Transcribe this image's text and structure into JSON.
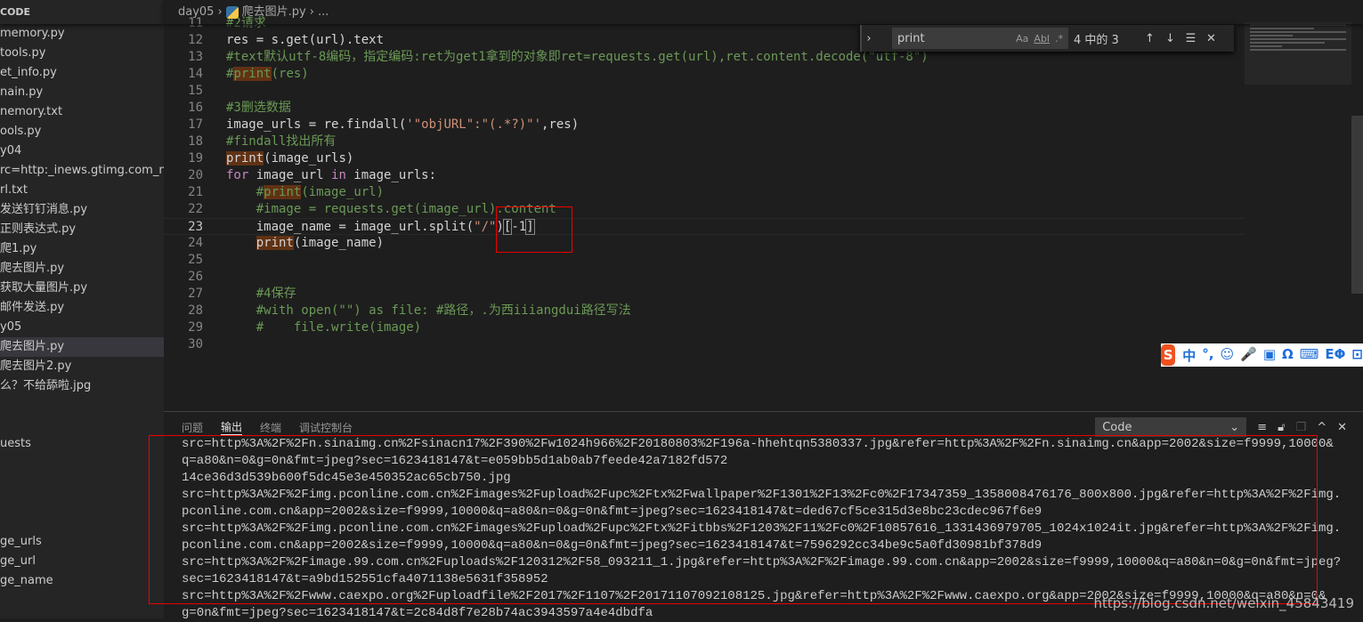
{
  "sidebar": {
    "header": "CODE",
    "items": [
      "memory.py",
      "tools.py",
      "et_info.py",
      "nain.py",
      "nemory.txt",
      "ools.py",
      "y04",
      "rc=http:_inews.gtimg.com_ne...",
      "rl.txt",
      "发送钉钉消息.py",
      "正则表达式.py",
      "爬1.py",
      "爬去图片.py",
      "获取大量图片.py",
      "邮件发送.py",
      "y05",
      "爬去图片.py",
      "爬去图片2.py",
      "么？不给舔啦.jpg"
    ],
    "selected_index": 16,
    "outline": [
      "uests",
      "",
      "",
      "",
      "",
      "ge_urls",
      "ge_url",
      "ge_name"
    ]
  },
  "breadcrumb": {
    "folder": "day05",
    "file": "爬去图片.py",
    "more": "..."
  },
  "find": {
    "query": "print",
    "case_label": "Aa",
    "word_label": "Abl",
    "regex_label": ".*",
    "count": "4 中的 3"
  },
  "code": [
    {
      "n": "11",
      "t": [
        [
          "#2请求",
          "c"
        ]
      ]
    },
    {
      "n": "12",
      "t": [
        [
          "res = s.get(url).text",
          "d"
        ]
      ]
    },
    {
      "n": "13",
      "t": [
        [
          "#text默认utf-8编码，指定编码:ret为get1拿到的对象即ret=requests.get(url),ret.content.decode(\"utf-8\")",
          "c"
        ]
      ]
    },
    {
      "n": "14",
      "t": [
        [
          "#",
          "c"
        ],
        [
          "print",
          "c m"
        ],
        [
          "(res)",
          "c"
        ]
      ]
    },
    {
      "n": "15",
      "t": []
    },
    {
      "n": "16",
      "t": [
        [
          "#3删选数据",
          "c"
        ]
      ]
    },
    {
      "n": "17",
      "t": [
        [
          "image_urls = re.findall(",
          "d"
        ],
        [
          "'\"objURL\":\"(.*?)\"'",
          "s"
        ],
        [
          ",res)",
          "d"
        ]
      ]
    },
    {
      "n": "18",
      "t": [
        [
          "#findall找出所有",
          "c"
        ]
      ]
    },
    {
      "n": "19",
      "t": [
        [
          "print",
          "d m"
        ],
        [
          "(image_urls)",
          "d"
        ]
      ]
    },
    {
      "n": "20",
      "t": [
        [
          "for",
          "k"
        ],
        [
          " image_url ",
          "d"
        ],
        [
          "in",
          "k"
        ],
        [
          " image_urls:",
          "d"
        ]
      ]
    },
    {
      "n": "21",
      "t": [
        [
          "    #",
          "c"
        ],
        [
          "print",
          "c m"
        ],
        [
          "(image_url)",
          "c"
        ]
      ]
    },
    {
      "n": "22",
      "t": [
        [
          "    #image = requests.get(image_url).content",
          "c"
        ]
      ]
    },
    {
      "n": "23",
      "t": [
        [
          "    image_name = image_url.split(",
          "d"
        ],
        [
          "\"/\"",
          "s"
        ],
        [
          ")",
          "d"
        ],
        [
          "[",
          "d b"
        ],
        [
          "-1",
          "d"
        ],
        [
          "]",
          "d b"
        ]
      ],
      "current": true
    },
    {
      "n": "24",
      "t": [
        [
          "    ",
          "d"
        ],
        [
          "print",
          "d m"
        ],
        [
          "(image_name)",
          "d"
        ]
      ]
    },
    {
      "n": "25",
      "t": []
    },
    {
      "n": "26",
      "t": []
    },
    {
      "n": "27",
      "t": [
        [
          "    #4保存",
          "c"
        ]
      ]
    },
    {
      "n": "28",
      "t": [
        [
          "    #with open(\"\") as file: #路径，.为西iiiangdui路径写法",
          "c"
        ]
      ]
    },
    {
      "n": "29",
      "t": [
        [
          "    #    file.write(image)",
          "c"
        ]
      ]
    },
    {
      "n": "30",
      "t": []
    }
  ],
  "panel": {
    "tabs": [
      "问题",
      "输出",
      "终端",
      "调试控制台"
    ],
    "active": 1,
    "channel": "Code",
    "output": [
      "src=http%3A%2F%2Fn.sinaimg.cn%2Fsinacn17%2F390%2Fw1024h966%2F20180803%2F196a-hhehtqn5380337.jpg&refer=http%3A%2F%2Fn.sinaimg.cn&app=2002&size=f9999,10000&",
      "q=a80&n=0&g=0n&fmt=jpeg?sec=1623418147&t=e059bb5d1ab0ab7feede42a7182fd572",
      "14ce36d3d539b600f5dc45e3e450352ac65cb750.jpg",
      "src=http%3A%2F%2Fimg.pconline.com.cn%2Fimages%2Fupload%2Fupc%2Ftx%2Fwallpaper%2F1301%2F13%2Fc0%2F17347359_1358008476176_800x800.jpg&refer=http%3A%2F%2Fimg.",
      "pconline.com.cn&app=2002&size=f9999,10000&q=a80&n=0&g=0n&fmt=jpeg?sec=1623418147&t=ded67cf5ce315d3e8bc23cdec967f6e9",
      "src=http%3A%2F%2Fimg.pconline.com.cn%2Fimages%2Fupload%2Fupc%2Ftx%2Fitbbs%2F1203%2F11%2Fc0%2F10857616_1331436979705_1024x1024it.jpg&refer=http%3A%2F%2Fimg.",
      "pconline.com.cn&app=2002&size=f9999,10000&q=a80&n=0&g=0n&fmt=jpeg?sec=1623418147&t=7596292cc34be9c5a0fd30981bf378d9",
      "src=http%3A%2F%2Fimage.99.com.cn%2Fuploads%2F120312%2F58_093211_1.jpg&refer=http%3A%2F%2Fimage.99.com.cn&app=2002&size=f9999,10000&q=a80&n=0&g=0n&fmt=jpeg?",
      "sec=1623418147&t=a9bd152551cfa4071138e5631f358952",
      "src=http%3A%2F%2Fwww.caexpo.org%2Fuploadfile%2F2017%2F1107%2F20171107092108125.jpg&refer=http%3A%2F%2Fwww.caexpo.org&app=2002&size=f9999,10000&q=a80&n=0&",
      "g=0n&fmt=jpeg?sec=1623418147&t=2c84d8f7e28b74ac3943597a4e4dbdfa"
    ]
  },
  "ime": {
    "logo": "S",
    "items": [
      "中",
      "°,",
      "☺",
      "🎤",
      "▣",
      "Ω",
      "⌨",
      "EΦ",
      "⊡"
    ]
  },
  "watermark": "https://blog.csdn.net/weixin_45843419",
  "colors": {
    "comment": "#6a9955",
    "keyword": "#c586c0",
    "string": "#ce9178",
    "find_match": "#613214",
    "annotation": "#e00000"
  }
}
